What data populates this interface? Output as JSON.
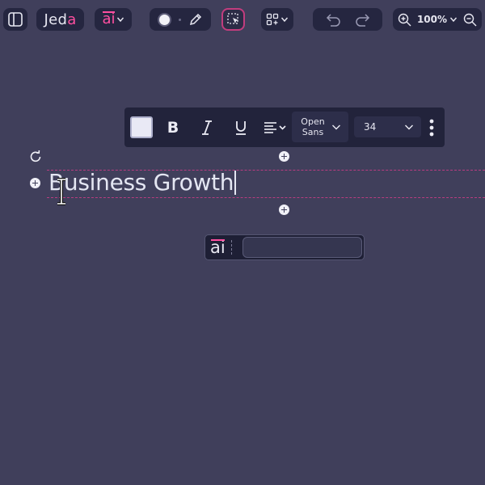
{
  "app": {
    "logo_prefix": "Jed",
    "logo_accent": "a",
    "ai_label": "ai"
  },
  "toolbar": {
    "zoom_level": "100%"
  },
  "format_bar": {
    "bold_label": "B",
    "italic_label": "I",
    "underline_label": "U",
    "font_line1": "Open",
    "font_line2": "Sans",
    "font_size": "34"
  },
  "canvas": {
    "title_text": "Business Growth"
  },
  "ai_prompt": {
    "label": "ai",
    "input_value": ""
  },
  "colors": {
    "background": "#403f5b",
    "panel": "#252640",
    "accent": "#ff4fa0",
    "guide": "#b83c80"
  }
}
